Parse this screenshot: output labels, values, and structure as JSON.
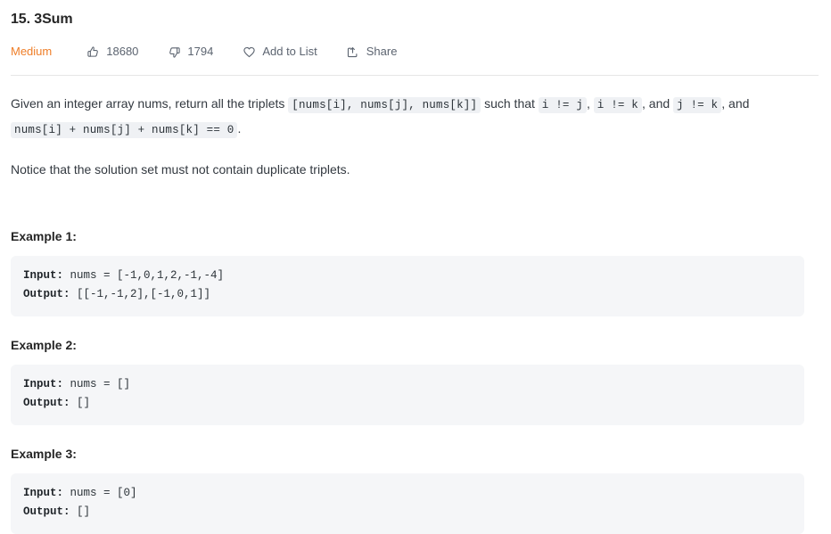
{
  "problem": {
    "title": "15. 3Sum",
    "difficulty": "Medium",
    "difficulty_color": "#EF7E28"
  },
  "actions": [
    {
      "name": "upvote",
      "icon": "thumbs-up-icon",
      "label": "18680"
    },
    {
      "name": "downvote",
      "icon": "thumbs-down-icon",
      "label": "1794"
    },
    {
      "name": "add-to-list",
      "icon": "heart-icon",
      "label": "Add to List"
    },
    {
      "name": "share",
      "icon": "share-icon",
      "label": "Share"
    }
  ],
  "description": {
    "para1": {
      "seg1": "Given an integer array nums, return all the triplets ",
      "code1": "[nums[i], nums[j], nums[k]]",
      "seg2": " such that ",
      "code2": "i != j",
      "seg3": ", ",
      "code3": "i != k",
      "seg4": ", and ",
      "code4": "j != k",
      "seg5": ", and ",
      "code5": "nums[i] + nums[j] + nums[k] == 0",
      "seg6": "."
    },
    "para2": "Notice that the solution set must not contain duplicate triplets."
  },
  "examples": [
    {
      "heading": "Example 1:",
      "input_label": "Input:",
      "input_value": " nums = [-1,0,1,2,-1,-4]",
      "output_label": "Output:",
      "output_value": " [[-1,-1,2],[-1,0,1]]"
    },
    {
      "heading": "Example 2:",
      "input_label": "Input:",
      "input_value": " nums = []",
      "output_label": "Output:",
      "output_value": " []"
    },
    {
      "heading": "Example 3:",
      "input_label": "Input:",
      "input_value": " nums = [0]",
      "output_label": "Output:",
      "output_value": " []"
    }
  ]
}
